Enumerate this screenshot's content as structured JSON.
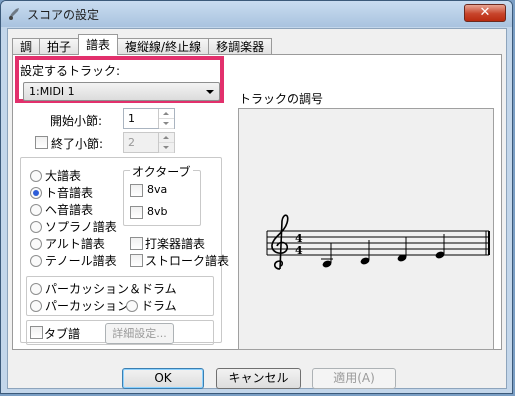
{
  "window": {
    "title": "スコアの設定",
    "close_label": "✕"
  },
  "tabs": [
    {
      "label": "調",
      "active": false
    },
    {
      "label": "拍子",
      "active": false
    },
    {
      "label": "譜表",
      "active": true
    },
    {
      "label": "複縦線/終止線",
      "active": false
    },
    {
      "label": "移調楽器",
      "active": false
    }
  ],
  "track": {
    "label": "設定するトラック:",
    "selected": "1:MIDI 1"
  },
  "start_measure": {
    "label": "開始小節:",
    "value": "1"
  },
  "end_measure": {
    "label": "終了小節:",
    "value": "2",
    "checked": false
  },
  "staff_types": {
    "grand": "大譜表",
    "treble": "ト音譜表",
    "bass": "ヘ音譜表",
    "soprano": "ソプラノ譜表",
    "alto": "アルト譜表",
    "tenor": "テノール譜表",
    "selected": "ト音譜表"
  },
  "octave": {
    "title": "オクターブ",
    "va": "8va",
    "vb": "8vb"
  },
  "percussion_staff": "打楽器譜表",
  "stroke_staff": "ストローク譜表",
  "percussion_group": {
    "perc_drum": "パーカッション＆ドラム",
    "perc": "パーカッション",
    "drum": "ドラム"
  },
  "tab": {
    "label": "タブ譜",
    "detail_button": "詳細設定..."
  },
  "preview": {
    "title": "トラックの調号",
    "time_signature": [
      "4",
      "4"
    ]
  },
  "buttons": {
    "ok": "OK",
    "cancel": "キャンセル",
    "apply": "適用(A)"
  }
}
